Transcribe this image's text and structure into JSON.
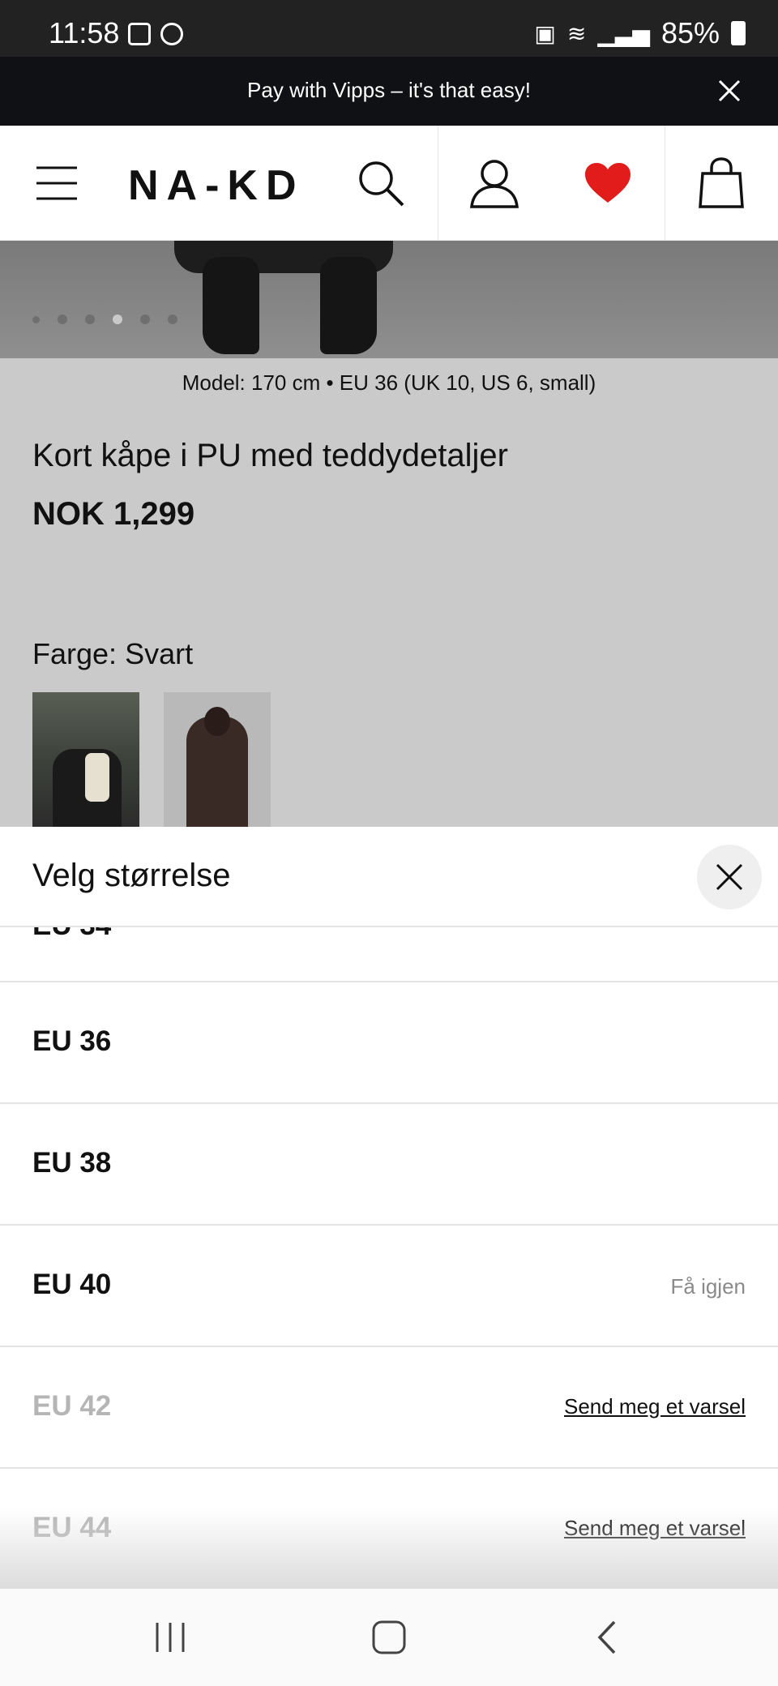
{
  "status_bar": {
    "time": "11:58",
    "battery": "85%"
  },
  "promo": {
    "text": "Pay with Vipps – it's that easy!"
  },
  "header": {
    "logo": "NA-KD",
    "wishlist_color": "#e21b1b"
  },
  "gallery": {
    "slide_count": 6,
    "active_index": 3
  },
  "product": {
    "model_info": "Model: 170 cm • EU 36 (UK 10, US 6, small)",
    "title": "Kort kåpe i PU med teddydetaljer",
    "price": "NOK 1,299",
    "color_label": "Farge:",
    "color_value": "Svart"
  },
  "size_sheet": {
    "title": "Velg størrelse",
    "sizes": [
      {
        "label": "EU 36",
        "meta": ""
      },
      {
        "label": "EU 38",
        "meta": ""
      },
      {
        "label": "EU 40",
        "meta": "Få igjen"
      },
      {
        "label": "EU 42",
        "notify": "Send meg et varsel"
      },
      {
        "label": "EU 44",
        "notify": "Send meg et varsel"
      }
    ]
  }
}
